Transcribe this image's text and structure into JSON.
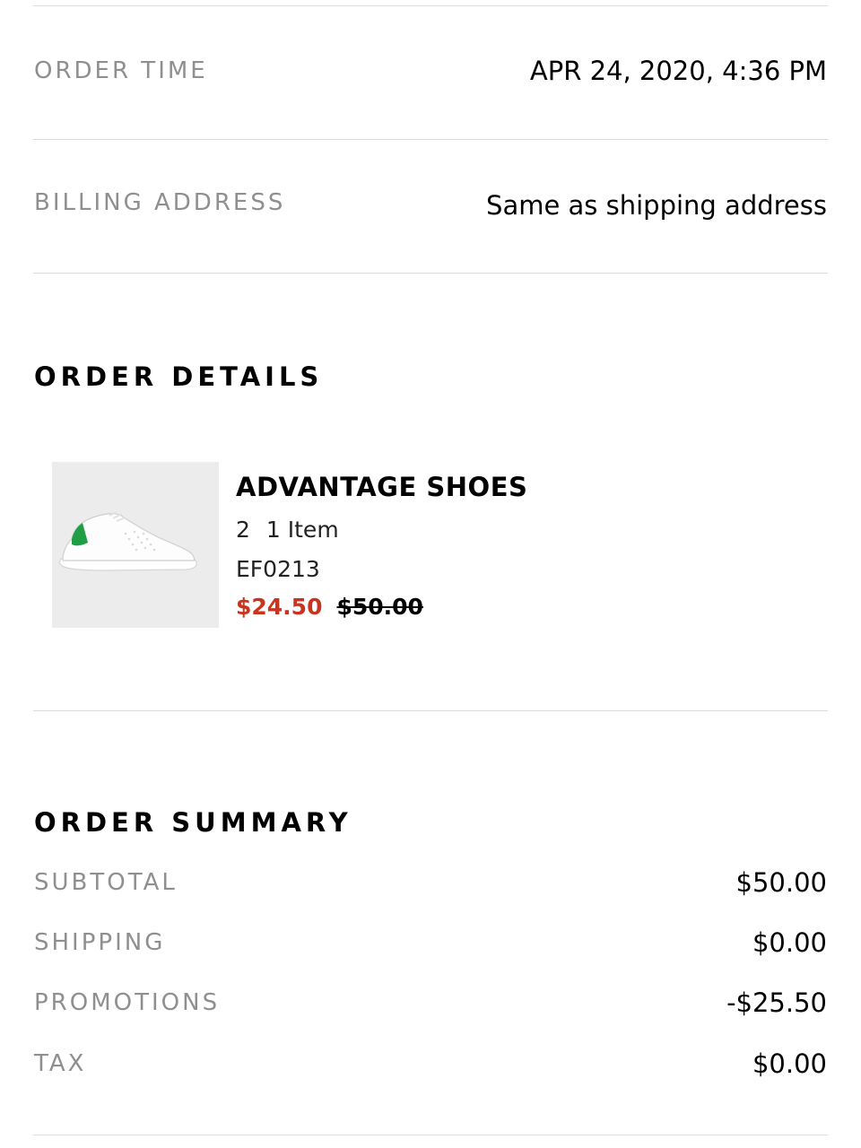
{
  "order_time": {
    "label": "ORDER TIME",
    "value": "APR 24, 2020, 4:36 PM"
  },
  "billing_address": {
    "label": "BILLING ADDRESS",
    "value": "Same as shipping address"
  },
  "order_details": {
    "heading": "ORDER DETAILS",
    "item": {
      "name": "ADVANTAGE SHOES",
      "size": "2",
      "quantity": "1 Item",
      "sku": "EF0213",
      "sale_price": "$24.50",
      "original_price": "$50.00",
      "image_icon": "white-sneaker-green-heel-image"
    }
  },
  "order_summary": {
    "heading": "ORDER SUMMARY",
    "rows": [
      {
        "label": "SUBTOTAL",
        "value": "$50.00"
      },
      {
        "label": "SHIPPING",
        "value": "$0.00"
      },
      {
        "label": "PROMOTIONS",
        "value": "-$25.50"
      },
      {
        "label": "TAX",
        "value": "$0.00"
      }
    ]
  },
  "colors": {
    "sale_price": "#c9341e",
    "muted_label": "#8f8f8f",
    "divider": "#dcdcdc",
    "thumb_bg": "#ececec",
    "sneaker_heel": "#1f9e45"
  }
}
